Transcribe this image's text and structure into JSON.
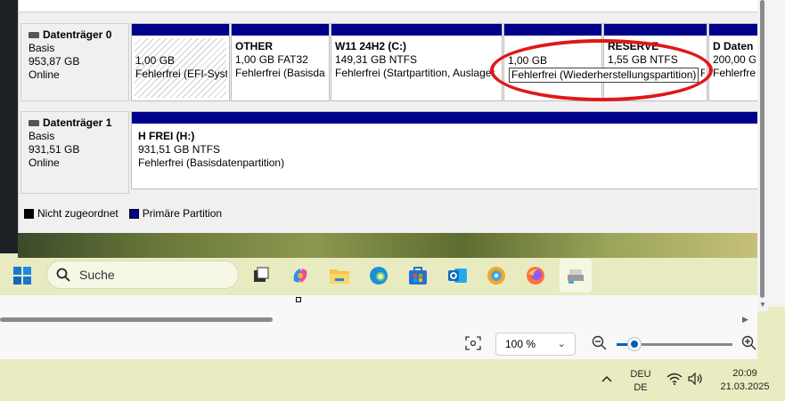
{
  "disks": [
    {
      "name": "Datenträger 0",
      "type": "Basis",
      "size": "953,87 GB",
      "status": "Online",
      "partitions": [
        {
          "title": "",
          "size": "1,00 GB",
          "status": "Fehlerfrei (EFI-Syst"
        },
        {
          "title": "OTHER",
          "size": "1,00 GB FAT32",
          "status": "Fehlerfrei (Basisda"
        },
        {
          "title": "W11 24H2  (C:)",
          "size": "149,31 GB NTFS",
          "status": "Fehlerfrei (Startpartition, Auslager"
        },
        {
          "title": "",
          "size": "1,00 GB",
          "status": "Fehlerfrei (Wiederherstellungspartition)"
        },
        {
          "title": "RESERVE",
          "size": "1,55 GB NTFS",
          "status": "Fe"
        },
        {
          "title": "D Daten",
          "size": "200,00 GB",
          "status": "Fehlerfrei"
        }
      ]
    },
    {
      "name": "Datenträger 1",
      "type": "Basis",
      "size": "931,51 GB",
      "status": "Online",
      "partitions": [
        {
          "title": "H FREI  (H:)",
          "size": "931,51 GB NTFS",
          "status": "Fehlerfrei (Basisdatenpartition)"
        }
      ]
    }
  ],
  "legend": [
    {
      "label": "Nicht zugeordnet",
      "color": "#000000"
    },
    {
      "label": "Primäre Partition",
      "color": "#00008b"
    }
  ],
  "taskbar": {
    "search_placeholder": "Suche",
    "apps": [
      "windows-start",
      "task-view",
      "copilot",
      "file-explorer",
      "edge",
      "microsoft-store",
      "outlook",
      "maps",
      "firefox",
      "disk-management"
    ]
  },
  "viewer": {
    "zoom_label": "100 %",
    "zoom_level": 0.15
  },
  "tray": {
    "language_line1": "DEU",
    "language_line2": "DE",
    "time": "20:09",
    "date": "21.03.2025"
  },
  "colors": {
    "primary_partition": "#00008b",
    "annotation": "#e01818",
    "accent": "#005fb8"
  }
}
